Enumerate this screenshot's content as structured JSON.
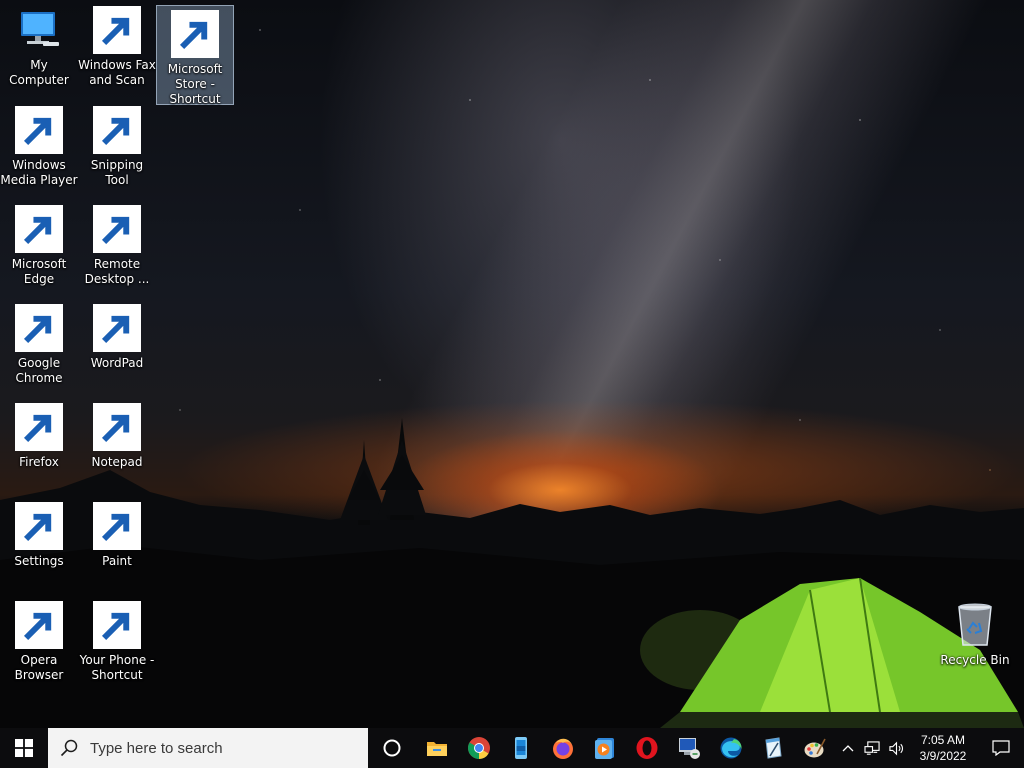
{
  "desktop": {
    "icons": [
      {
        "label": "My Computer",
        "icon": "computer-icon",
        "shortcut": false
      },
      {
        "label": "Windows Fax and Scan",
        "icon": "fax-icon",
        "shortcut": true
      },
      {
        "label": "Microsoft Store - Shortcut",
        "icon": "microsoft-store-icon",
        "shortcut": true,
        "selected": true
      },
      {
        "label": "Windows Media Player",
        "icon": "media-player-icon",
        "shortcut": true
      },
      {
        "label": "Snipping Tool",
        "icon": "snipping-tool-icon",
        "shortcut": true
      },
      {
        "label": "Microsoft Edge",
        "icon": "edge-icon",
        "shortcut": true
      },
      {
        "label": "Remote Desktop ...",
        "icon": "remote-desktop-icon",
        "shortcut": true
      },
      {
        "label": "Google Chrome",
        "icon": "chrome-icon",
        "shortcut": true
      },
      {
        "label": "WordPad",
        "icon": "wordpad-icon",
        "shortcut": true
      },
      {
        "label": "Firefox",
        "icon": "firefox-icon",
        "shortcut": true
      },
      {
        "label": "Notepad",
        "icon": "notepad-icon",
        "shortcut": true
      },
      {
        "label": "Settings",
        "icon": "settings-icon",
        "shortcut": true
      },
      {
        "label": "Paint",
        "icon": "paint-icon",
        "shortcut": true
      },
      {
        "label": "Opera Browser",
        "icon": "opera-icon",
        "shortcut": true
      },
      {
        "label": "Your Phone - Shortcut",
        "icon": "your-phone-icon",
        "shortcut": true
      },
      {
        "label": "Recycle Bin",
        "icon": "recycle-bin-icon",
        "shortcut": false
      }
    ]
  },
  "taskbar": {
    "start_icon": "windows-logo-icon",
    "search": {
      "placeholder": "Type here to search",
      "icon": "search-icon"
    },
    "cortana_icon": "cortana-icon",
    "pinned": [
      "file-explorer-icon",
      "chrome-icon",
      "your-phone-icon",
      "firefox-icon",
      "media-player-icon",
      "opera-icon",
      "remote-desktop-icon",
      "edge-icon",
      "notepad-icon",
      "paint-icon"
    ],
    "tray_icons": [
      "chevron-up-icon",
      "network-icon",
      "volume-icon"
    ],
    "clock": {
      "time": "7:05 AM",
      "date": "3/9/2022"
    },
    "notification_icon": "action-center-icon"
  },
  "colors": {
    "taskbar_bg": "#0c0c0e",
    "search_bg": "#f3f3f3",
    "selection": "#99b4d1",
    "accent_blue": "#0078d7"
  }
}
